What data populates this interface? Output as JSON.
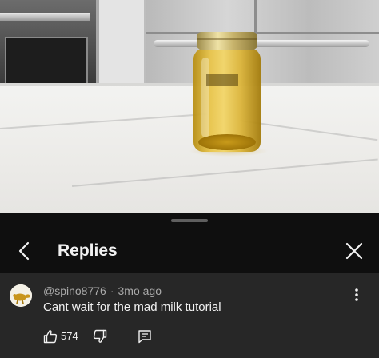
{
  "replies_panel": {
    "title": "Replies",
    "back_icon": "chevron-left-icon",
    "close_icon": "close-icon"
  },
  "comment": {
    "author": "@spino8776",
    "separator": "·",
    "time_ago": "3mo ago",
    "text": "Cant wait for the mad milk tutorial",
    "like_count": "574",
    "avatar_icon": "user-avatar",
    "more_icon": "more-vertical-icon",
    "like_icon": "thumb-up-icon",
    "dislike_icon": "thumb-down-icon",
    "reply_icon": "reply-comment-icon"
  },
  "colors": {
    "panel_bg": "#0f0f0f",
    "comment_bg": "#272727",
    "text_primary": "#f1f1f1",
    "text_secondary": "#aaaaaa"
  }
}
